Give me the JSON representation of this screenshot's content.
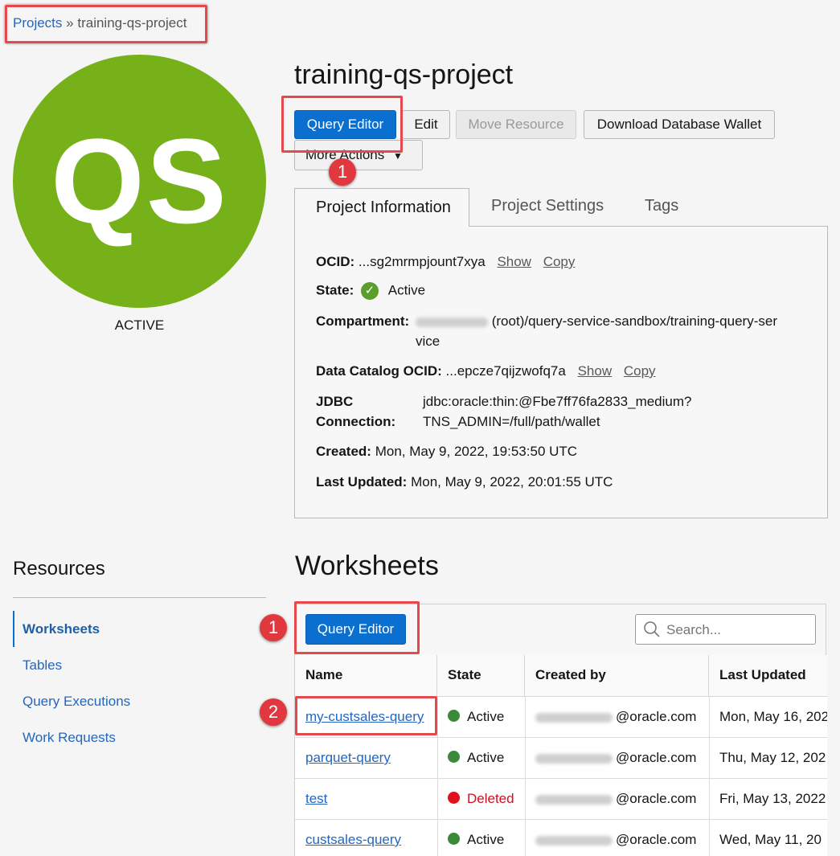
{
  "breadcrumb": {
    "root": "Projects",
    "sep": "»",
    "current": "training-qs-project"
  },
  "avatar": {
    "initials": "QS",
    "status": "ACTIVE",
    "color": "#76b119"
  },
  "page_title": "training-qs-project",
  "actions": {
    "query_editor": "Query Editor",
    "edit": "Edit",
    "move_resource": "Move Resource",
    "download_wallet": "Download Database Wallet",
    "more_actions": "More Actions"
  },
  "callouts": {
    "one": "1",
    "two": "2"
  },
  "tabs": [
    "Project Information",
    "Project Settings",
    "Tags"
  ],
  "info": {
    "ocid_label": "OCID:",
    "ocid_value": "...sg2mrmpjount7xya",
    "show": "Show",
    "copy": "Copy",
    "state_label": "State:",
    "state_value": "Active",
    "compartment_label": "Compartment:",
    "compartment_value_1": "(root)/query-service-sandbox/training-query-ser",
    "compartment_value_2": "vice",
    "catalog_label": "Data Catalog OCID:",
    "catalog_value": "...epcze7qijzwofq7a",
    "jdbc_label_1": "JDBC",
    "jdbc_label_2": "Connection:",
    "jdbc_value_1": "jdbc:oracle:thin:@Fbe7ff76fa2833_medium?",
    "jdbc_value_2": "TNS_ADMIN=/full/path/wallet",
    "created_label": "Created:",
    "created_value": "Mon, May 9, 2022, 19:53:50 UTC",
    "updated_label": "Last Updated:",
    "updated_value": "Mon, May 9, 2022, 20:01:55 UTC"
  },
  "sidebar": {
    "title": "Resources",
    "items": [
      "Worksheets",
      "Tables",
      "Query Executions",
      "Work Requests"
    ]
  },
  "worksheets": {
    "title": "Worksheets",
    "query_editor": "Query Editor",
    "search_placeholder": "Search...",
    "columns": [
      "Name",
      "State",
      "Created by",
      "Last Updated"
    ],
    "rows": [
      {
        "name": "my-custsales-query",
        "state": "Active",
        "created_by": "@oracle.com",
        "updated": "Mon, May 16, 202"
      },
      {
        "name": "parquet-query",
        "state": "Active",
        "created_by": "@oracle.com",
        "updated": "Thu, May 12, 202"
      },
      {
        "name": "test",
        "state": "Deleted",
        "created_by": "@oracle.com",
        "updated": "Fri, May 13, 2022"
      },
      {
        "name": "custsales-query",
        "state": "Active",
        "created_by": "@oracle.com",
        "updated": "Wed, May 11, 20"
      }
    ]
  },
  "colors": {
    "active": "#3a8a3a",
    "deleted": "#e0101e",
    "primary": "#0b6fd0",
    "highlight": "#e5484d"
  }
}
